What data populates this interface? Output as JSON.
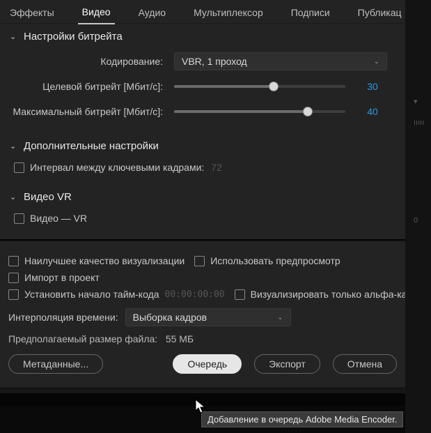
{
  "tabs": {
    "effects": "Эффекты",
    "video": "Видео",
    "audio": "Аудио",
    "multiplexer": "Мультиплексор",
    "captions": "Подписи",
    "publish": "Публикац",
    "more": "»"
  },
  "bitrate": {
    "title": "Настройки битрейта",
    "encoding_label": "Кодирование:",
    "encoding_value": "VBR, 1 проход",
    "target_label": "Целевой битрейт [Мбит/с]:",
    "target_value": "30",
    "target_pct": 58,
    "max_label": "Максимальный битрейт [Мбит/с]:",
    "max_value": "40",
    "max_pct": 78
  },
  "advanced": {
    "title": "Дополнительные настройки",
    "keyframe_label": "Интервал между ключевыми кадрами:",
    "keyframe_value": "72"
  },
  "vr": {
    "title": "Видео VR",
    "checkbox_label": "Видео — VR"
  },
  "options": {
    "best_quality": "Наилучшее качество визуализации",
    "use_preview": "Использовать предпросмотр",
    "import_project": "Импорт в проект",
    "set_timecode": "Установить начало тайм-кода",
    "timecode_value": "00:00:00:00",
    "alpha_only": "Визуализировать только альфа-кана"
  },
  "interpolation": {
    "label": "Интерполяция времени:",
    "value": "Выборка кадров"
  },
  "size": {
    "label": "Предполагаемый размер файла:",
    "value": "55 МБ"
  },
  "buttons": {
    "metadata": "Метаданные...",
    "queue": "Очередь",
    "export": "Экспорт",
    "cancel": "Отмена"
  },
  "tooltip": "Добавление в очередь Adobe Media Encoder.",
  "right_marker": "0"
}
